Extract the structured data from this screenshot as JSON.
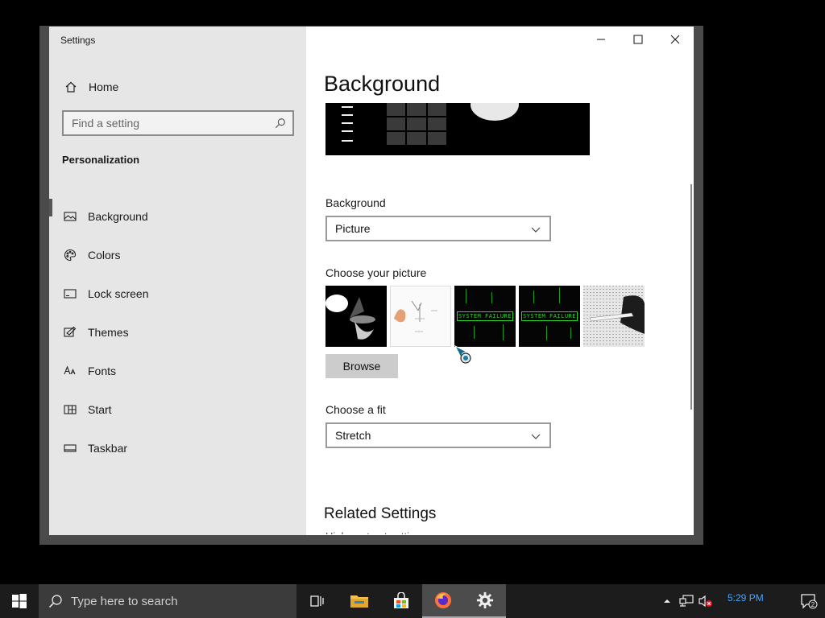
{
  "window": {
    "title": "Settings"
  },
  "sidebar": {
    "home_label": "Home",
    "search_placeholder": "Find a setting",
    "section_title": "Personalization",
    "items": [
      {
        "label": "Background",
        "icon": "image-icon",
        "active": true
      },
      {
        "label": "Colors",
        "icon": "palette-icon",
        "active": false
      },
      {
        "label": "Lock screen",
        "icon": "lock-screen-icon",
        "active": false
      },
      {
        "label": "Themes",
        "icon": "themes-icon",
        "active": false
      },
      {
        "label": "Fonts",
        "icon": "fonts-icon",
        "active": false
      },
      {
        "label": "Start",
        "icon": "start-icon",
        "active": false
      },
      {
        "label": "Taskbar",
        "icon": "taskbar-icon",
        "active": false
      }
    ]
  },
  "main": {
    "page_title": "Background",
    "background_label": "Background",
    "background_value": "Picture",
    "choose_picture_label": "Choose your picture",
    "thumbnails": [
      {
        "id": "thumb-1"
      },
      {
        "id": "thumb-2"
      },
      {
        "id": "thumb-3",
        "text": "SYSTEM FAILURE"
      },
      {
        "id": "thumb-4",
        "text": "SYSTEM FAILURE"
      },
      {
        "id": "thumb-5"
      }
    ],
    "browse_label": "Browse",
    "choose_fit_label": "Choose a fit",
    "fit_value": "Stretch",
    "related_settings_title": "Related Settings",
    "related_settings_cut": "High contrast settings"
  },
  "taskbar": {
    "search_placeholder": "Type here to search",
    "clock_time": "5:29 PM",
    "notification_count": "2"
  },
  "colors": {
    "accent_green": "#2bd42b",
    "clock_blue": "#4aa3ff",
    "taskbar_bg": "#1c1c1c"
  }
}
